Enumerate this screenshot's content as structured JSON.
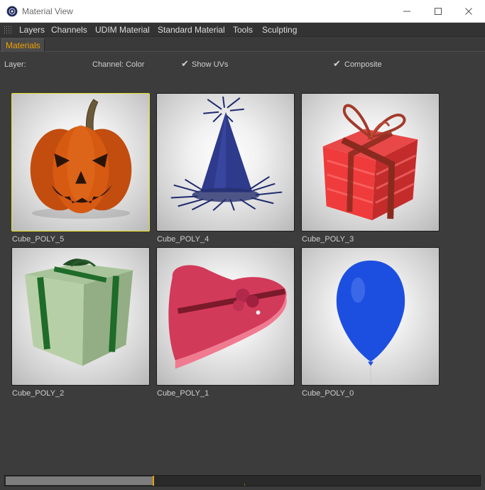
{
  "window": {
    "title": "Material View",
    "icon": "cinema4d-icon",
    "controls": [
      "minimize-icon",
      "maximize-icon",
      "close-icon"
    ]
  },
  "menu": {
    "items": [
      "Layers",
      "Channels",
      "UDIM Material",
      "Standard Material",
      "Tools",
      "Sculpting"
    ]
  },
  "tabs": {
    "active": "Materials"
  },
  "options": {
    "layer_label": "Layer:",
    "channel_label": "Channel: Color",
    "show_uvs": {
      "label": "Show UVs",
      "checked": true
    },
    "composite": {
      "label": "Composite",
      "checked": true
    }
  },
  "materials": [
    {
      "name": "Cube_POLY_5",
      "preview": "pumpkin",
      "selected": true
    },
    {
      "name": "Cube_POLY_4",
      "preview": "party-hat",
      "selected": false
    },
    {
      "name": "Cube_POLY_3",
      "preview": "red-gift-box",
      "selected": false
    },
    {
      "name": "Cube_POLY_2",
      "preview": "green-gift-box",
      "selected": false
    },
    {
      "name": "Cube_POLY_1",
      "preview": "heart-box",
      "selected": false
    },
    {
      "name": "Cube_POLY_0",
      "preview": "blue-balloon",
      "selected": false
    }
  ],
  "colors": {
    "accent": "#f0a000",
    "selection": "#e6e12a",
    "panel": "#3c3c3c"
  },
  "scrollbar": {
    "position_fraction": 0.31
  }
}
